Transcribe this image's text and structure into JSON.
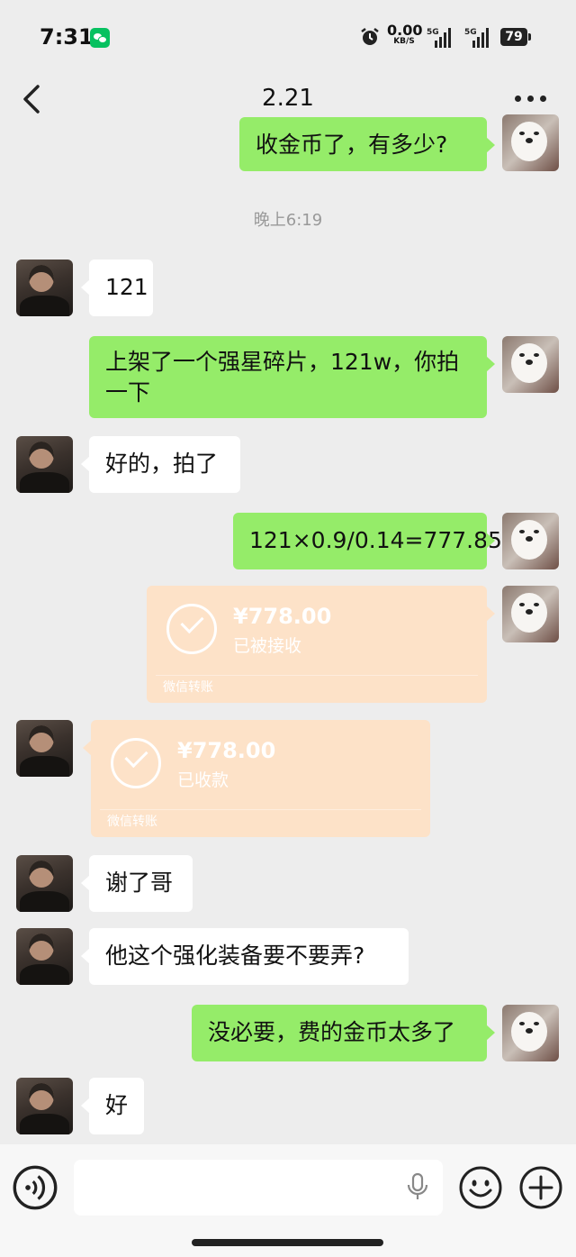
{
  "status_bar": {
    "time": "7:31",
    "net_speed_value": "0.00",
    "net_speed_unit": "KB/S",
    "sim1": "5G",
    "sim2": "5G",
    "battery": "79"
  },
  "header": {
    "title": "2.21",
    "back_icon": "chevron-left-icon",
    "more_icon": "more-dots-icon"
  },
  "messages": [
    {
      "side": "right",
      "text": "收金币了，有多少?"
    },
    {
      "type": "timestamp",
      "text": "晚上6:19"
    },
    {
      "side": "left",
      "text": "121"
    },
    {
      "side": "right",
      "text": "上架了一个强星碎片，121w，你拍一下"
    },
    {
      "side": "left",
      "text": "好的，拍了"
    },
    {
      "side": "right",
      "text": "121×0.9/0.14=777.85"
    },
    {
      "side": "right",
      "type": "transfer",
      "amount": "¥778.00",
      "status": "已被接收",
      "footer": "微信转账"
    },
    {
      "side": "left",
      "type": "transfer",
      "amount": "¥778.00",
      "status": "已收款",
      "footer": "微信转账"
    },
    {
      "side": "left",
      "text": "谢了哥"
    },
    {
      "side": "left",
      "text": "他这个强化装备要不要弄?"
    },
    {
      "side": "right",
      "text": "没必要，费的金币太多了"
    },
    {
      "side": "left",
      "text": "好"
    }
  ],
  "input_bar": {
    "voice_icon": "voice-toggle-icon",
    "mic_icon": "microphone-icon",
    "emoji_icon": "emoji-icon",
    "plus_icon": "plus-icon"
  },
  "colors": {
    "background": "#ededed",
    "my_bubble": "#95ec69",
    "their_bubble": "#ffffff",
    "transfer_card": "#fde2c8",
    "wechat_green": "#07c160"
  }
}
